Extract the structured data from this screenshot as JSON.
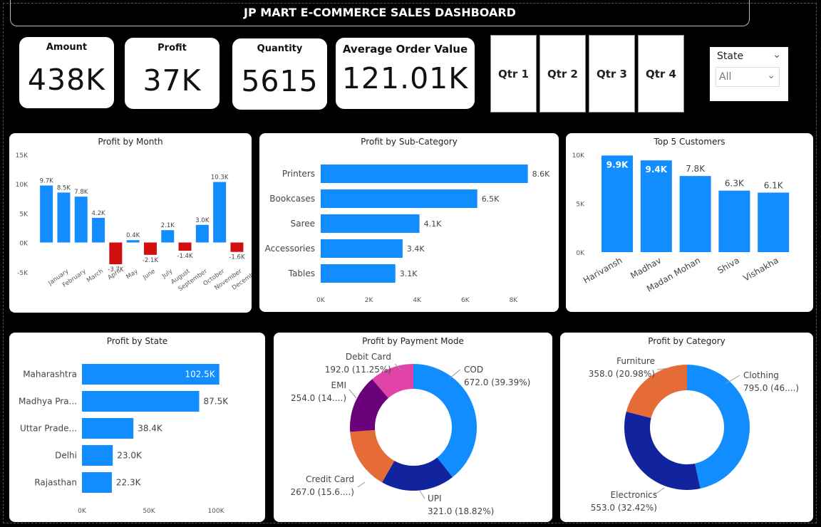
{
  "header": {
    "title": "JP MART E-COMMERCE  SALES DASHBOARD"
  },
  "kpis": [
    {
      "label": "Amount",
      "value": "438K"
    },
    {
      "label": "Profit",
      "value": "37K"
    },
    {
      "label": "Quantity",
      "value": "5615"
    },
    {
      "label": "Average Order Value",
      "value": "121.01K"
    }
  ],
  "quarters": [
    "Qtr 1",
    "Qtr 2",
    "Qtr 3",
    "Qtr 4"
  ],
  "state_filter": {
    "title": "State",
    "selected": "All"
  },
  "colors": {
    "bar": "#118dff",
    "negative": "#d10f0f",
    "dark_blue": "#12239e",
    "orange": "#e66c37",
    "purple": "#6b007b",
    "pink": "#e044a7"
  },
  "chart_data": [
    {
      "type": "bar",
      "title": "Profit by Month",
      "categories": [
        "January",
        "February",
        "March",
        "April",
        "May",
        "June",
        "July",
        "August",
        "September",
        "October",
        "November",
        "December"
      ],
      "values": [
        9700,
        8500,
        7800,
        4200,
        -3700,
        400,
        -2100,
        2100,
        -1400,
        3000,
        10300,
        -1600
      ],
      "data_labels": [
        "9.7K",
        "8.5K",
        "7.8K",
        "4.2K",
        "-3.7K",
        "0.4K",
        "-2.1K",
        "2.1K",
        "-1.4K",
        "3.0K",
        "10.3K",
        "-1.6K"
      ],
      "ylim": [
        -5000,
        15000
      ],
      "y_ticks": [
        {
          "v": 15000,
          "label": "15K"
        },
        {
          "v": 10000,
          "label": "10K"
        },
        {
          "v": 5000,
          "label": "5K"
        },
        {
          "v": 0,
          "label": "0K"
        },
        {
          "v": -5000,
          "label": "-5K"
        }
      ]
    },
    {
      "type": "bar",
      "orientation": "horizontal",
      "title": "Profit by Sub-Category",
      "categories": [
        "Printers",
        "Bookcases",
        "Saree",
        "Accessories",
        "Tables"
      ],
      "values": [
        8600,
        6500,
        4100,
        3400,
        3100
      ],
      "data_labels": [
        "8.6K",
        "6.5K",
        "4.1K",
        "3.4K",
        "3.1K"
      ],
      "xlim": [
        0,
        9000
      ],
      "x_ticks": [
        {
          "v": 0,
          "label": "0K"
        },
        {
          "v": 2000,
          "label": "2K"
        },
        {
          "v": 4000,
          "label": "4K"
        },
        {
          "v": 6000,
          "label": "6K"
        },
        {
          "v": 8000,
          "label": "8K"
        }
      ]
    },
    {
      "type": "bar",
      "title": "Top 5 Customers",
      "categories": [
        "Harivansh",
        "Madhav",
        "Madan Mohan",
        "Shiva",
        "Vishakha"
      ],
      "values": [
        9900,
        9400,
        7800,
        6300,
        6100
      ],
      "data_labels": [
        "9.9K",
        "9.4K",
        "7.8K",
        "6.3K",
        "6.1K"
      ],
      "ylim": [
        0,
        10000
      ],
      "y_ticks": [
        {
          "v": 10000,
          "label": "10K"
        },
        {
          "v": 5000,
          "label": "5K"
        },
        {
          "v": 0,
          "label": "0K"
        }
      ]
    },
    {
      "type": "bar",
      "orientation": "horizontal",
      "title": "Profit by State",
      "categories": [
        "Maharashtra",
        "Madhya Pra...",
        "Uttar Prade...",
        "Delhi",
        "Rajasthan"
      ],
      "values": [
        102500,
        87500,
        38400,
        23000,
        22300
      ],
      "data_labels": [
        "102.5K",
        "87.5K",
        "38.4K",
        "23.0K",
        "22.3K"
      ],
      "xlim": [
        0,
        100000
      ],
      "x_ticks": [
        {
          "v": 0,
          "label": "0K"
        },
        {
          "v": 50000,
          "label": "50K"
        },
        {
          "v": 100000,
          "label": "100K"
        }
      ]
    },
    {
      "type": "pie",
      "donut": true,
      "title": "Profit by Payment Mode",
      "slices": [
        {
          "name": "COD",
          "value": 672.0,
          "label": "672.0 (39.39%)",
          "color": "#118dff"
        },
        {
          "name": "UPI",
          "value": 321.0,
          "label": "321.0 (18.82%)",
          "color": "#12239e"
        },
        {
          "name": "Credit Card",
          "value": 267.0,
          "label": "267.0 (15.6....)",
          "color": "#e66c37"
        },
        {
          "name": "EMI",
          "value": 254.0,
          "label": "254.0 (14....)",
          "color": "#6b007b"
        },
        {
          "name": "Debit Card",
          "value": 192.0,
          "label": "192.0 (11.25%)",
          "color": "#e044a7"
        }
      ]
    },
    {
      "type": "pie",
      "donut": true,
      "title": "Profit by Category",
      "slices": [
        {
          "name": "Clothing",
          "value": 795.0,
          "label": "795.0 (46....)",
          "color": "#118dff"
        },
        {
          "name": "Electronics",
          "value": 553.0,
          "label": "553.0 (32.42%)",
          "color": "#12239e"
        },
        {
          "name": "Furniture",
          "value": 358.0,
          "label": "358.0 (20.98%)",
          "color": "#e66c37"
        }
      ]
    }
  ]
}
